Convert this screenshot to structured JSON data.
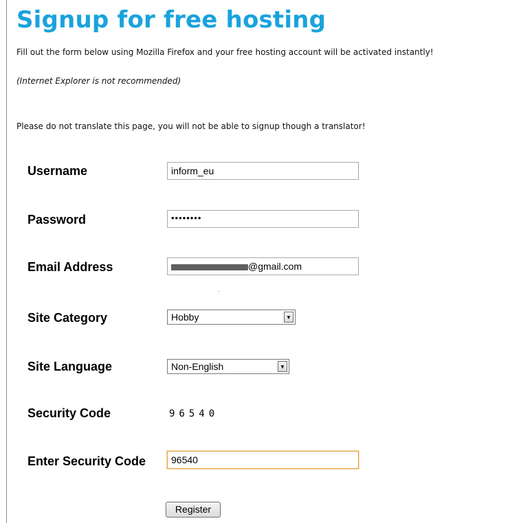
{
  "header": {
    "title": "Signup for free hosting",
    "intro": "Fill out the form below using Mozilla Firefox and your free hosting account will be activated instantly!",
    "browser_note": "(Internet Explorer is not recommended)",
    "translate_note": "Please do not translate this page, you will not be able to signup though a translator!"
  },
  "form": {
    "username": {
      "label": "Username",
      "value": "inform_eu"
    },
    "password": {
      "label": "Password",
      "value": "••••••••"
    },
    "email": {
      "label": "Email Address",
      "value_visible_suffix": "@gmail.com"
    },
    "site_category": {
      "label": "Site Category",
      "selected": "Hobby"
    },
    "site_language": {
      "label": "Site Language",
      "selected": "Non-English"
    },
    "security_code": {
      "label": "Security Code",
      "code": "96540"
    },
    "enter_security_code": {
      "label": "Enter Security Code",
      "value": "96540"
    },
    "register_label": "Register"
  },
  "icons": {
    "dropdown_arrow": "dropdown-arrow-icon"
  }
}
